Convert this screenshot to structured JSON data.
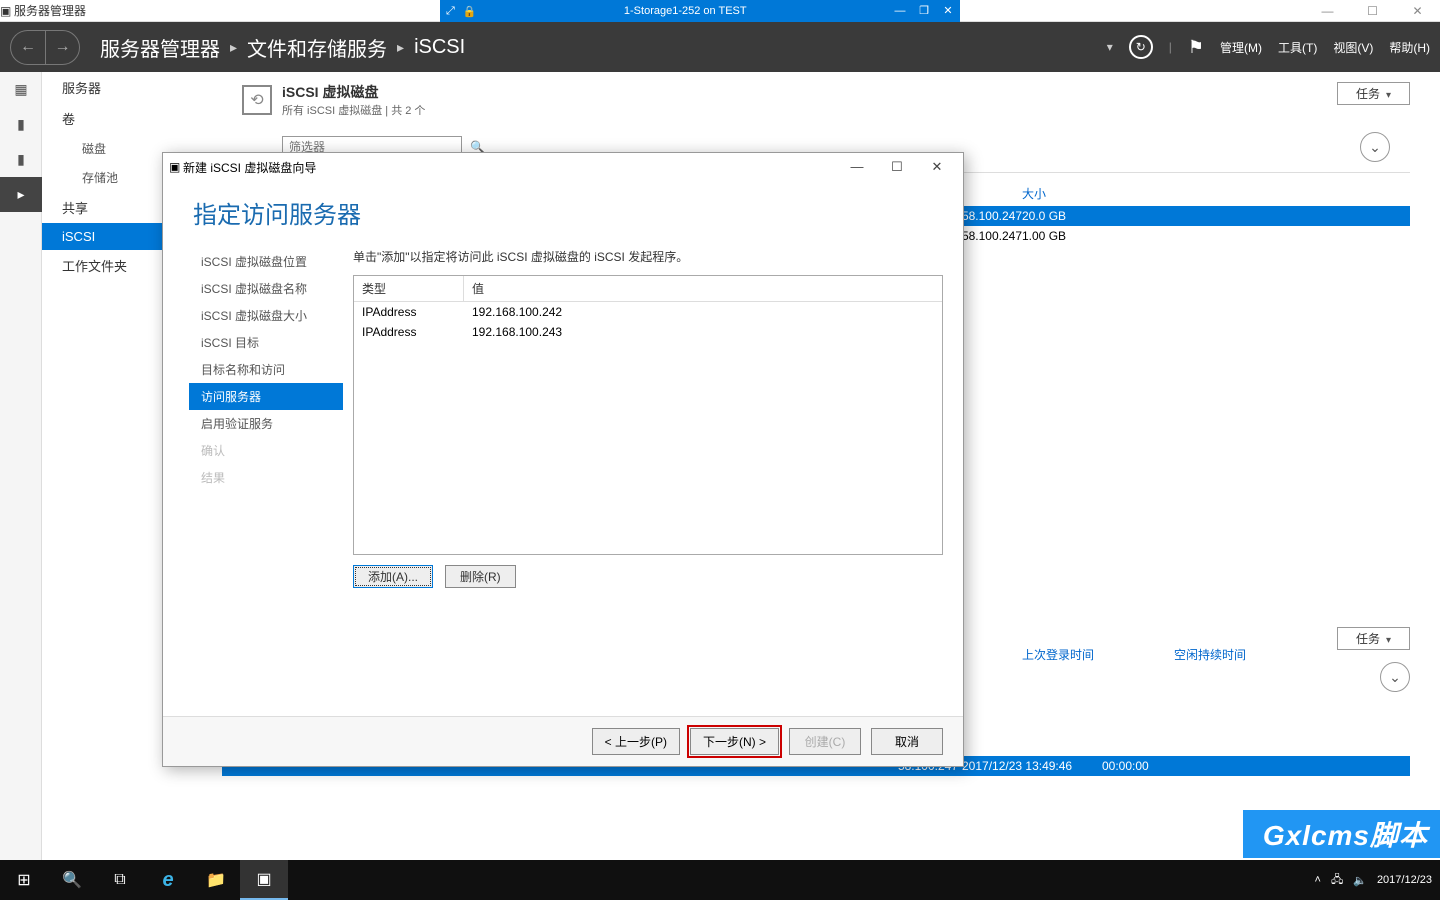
{
  "outer_window": {
    "title": "服务器管理器",
    "min": "—",
    "max": "☐",
    "close": "✕"
  },
  "vm_bar": {
    "pin_icon": "⤢",
    "lock_icon": "🔒",
    "label": "1-Storage1-252 on TEST",
    "min": "—",
    "max": "❐",
    "close": "✕"
  },
  "header": {
    "back": "←",
    "fwd": "→",
    "crumb1": "服务器管理器",
    "crumb2": "文件和存储服务",
    "crumb3": "iSCSI",
    "refresh": "↻",
    "flag": "⚑",
    "menu_manage": "管理(M)",
    "menu_tools": "工具(T)",
    "menu_view": "视图(V)",
    "menu_help": "帮助(H)"
  },
  "rail_icons": [
    "▦",
    "▮",
    "▮",
    "▸"
  ],
  "sidebar": {
    "items": [
      "服务器",
      "卷",
      "磁盘",
      "存储池",
      "共享",
      "iSCSI",
      "工作文件夹"
    ],
    "active_index": 5
  },
  "section": {
    "title": "iSCSI 虚拟磁盘",
    "sub": "所有 iSCSI 虚拟磁盘 | 共 2 个",
    "tasks": "任务",
    "filter_placeholder": "筛选器"
  },
  "table_head": {
    "size": "大小"
  },
  "rows": [
    {
      "ip": "58.100.247",
      "size": "20.0 GB",
      "selected": true
    },
    {
      "ip": "58.100.247",
      "size": "1.00 GB",
      "selected": false
    }
  ],
  "lower": {
    "col1": "上次登录时间",
    "col2": "空闲持续时间",
    "row_ip": "58.100.247",
    "row_time": "2017/12/23 13:49:46",
    "row_idle": "00:00:00"
  },
  "wizard": {
    "title": "新建 iSCSI 虚拟磁盘向导",
    "heading": "指定访问服务器",
    "desc": "单击\"添加\"以指定将访问此 iSCSI 虚拟磁盘的 iSCSI 发起程序。",
    "steps": [
      "iSCSI 虚拟磁盘位置",
      "iSCSI 虚拟磁盘名称",
      "iSCSI 虚拟磁盘大小",
      "iSCSI 目标",
      "目标名称和访问",
      "访问服务器",
      "启用验证服务",
      "确认",
      "结果"
    ],
    "table_head_type": "类型",
    "table_head_value": "值",
    "table_rows": [
      {
        "type": "IPAddress",
        "value": "192.168.100.242"
      },
      {
        "type": "IPAddress",
        "value": "192.168.100.243"
      }
    ],
    "btn_add": "添加(A)...",
    "btn_remove": "删除(R)",
    "btn_prev": "< 上一步(P)",
    "btn_next": "下一步(N) >",
    "btn_create": "创建(C)",
    "btn_cancel": "取消",
    "win_min": "—",
    "win_max": "☐",
    "win_close": "✕"
  },
  "taskbar": {
    "start": "⊞",
    "search": "🔍",
    "taskview": "⧉",
    "ie": "e",
    "explorer": "📁",
    "sm": "▣",
    "tray_up": "˄",
    "tray_net": "🖧",
    "tray_vol": "🔈",
    "clock": "2017/12/23"
  },
  "watermark": "Gxlcms脚本"
}
